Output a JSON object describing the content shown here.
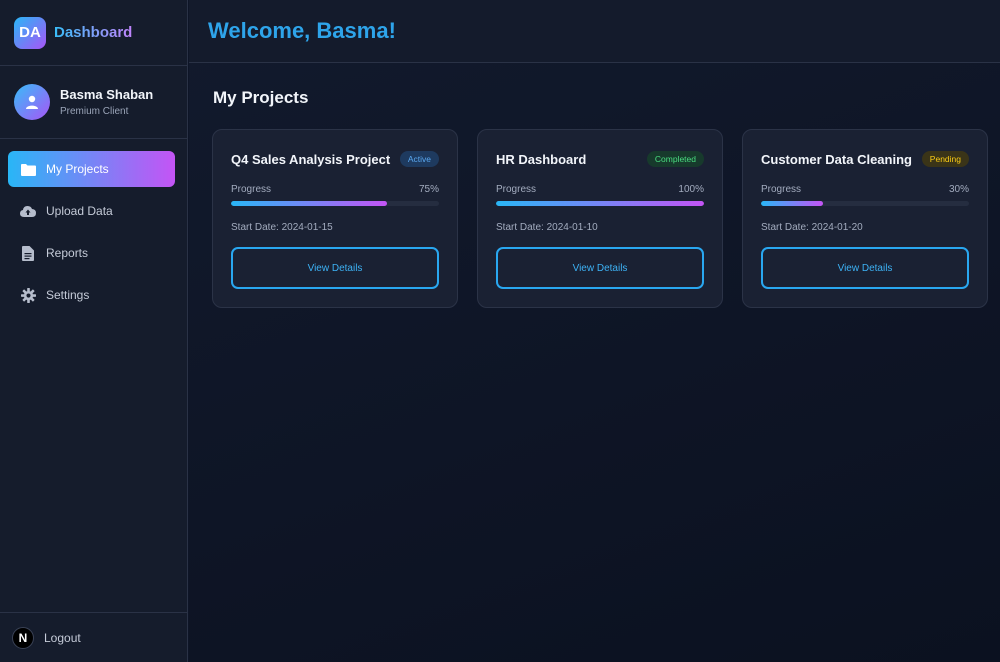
{
  "brand": {
    "logo_text": "DA",
    "title": "Dashboard"
  },
  "user": {
    "name": "Basma Shaban",
    "role": "Premium Client"
  },
  "nav": [
    {
      "label": "My Projects",
      "icon": "folder-icon",
      "active": true
    },
    {
      "label": "Upload Data",
      "icon": "cloud-upload-icon",
      "active": false
    },
    {
      "label": "Reports",
      "icon": "document-icon",
      "active": false
    },
    {
      "label": "Settings",
      "icon": "gear-icon",
      "active": false
    }
  ],
  "logout": {
    "label": "Logout",
    "icon_text": "N"
  },
  "header": {
    "welcome": "Welcome, Basma!"
  },
  "section_title": "My Projects",
  "projects": [
    {
      "title": "Q4 Sales Analysis Project",
      "status": "Active",
      "progress_label": "Progress",
      "progress_text": "75%",
      "progress": 0.75,
      "start_date": "Start Date: 2024-01-15",
      "button": "View Details"
    },
    {
      "title": "HR Dashboard",
      "status": "Completed",
      "progress_label": "Progress",
      "progress_text": "100%",
      "progress": 1.0,
      "start_date": "Start Date: 2024-01-10",
      "button": "View Details"
    },
    {
      "title": "Customer Data Cleaning",
      "status": "Pending",
      "progress_label": "Progress",
      "progress_text": "30%",
      "progress": 0.3,
      "start_date": "Start Date: 2024-01-20",
      "button": "View Details"
    }
  ],
  "colors": {
    "accent_blue": "#29b6f6",
    "accent_purple": "#c454f5",
    "background": "#0e1527",
    "status_active": "#5aa8f0",
    "status_completed": "#4ade80",
    "status_pending": "#facc15"
  }
}
